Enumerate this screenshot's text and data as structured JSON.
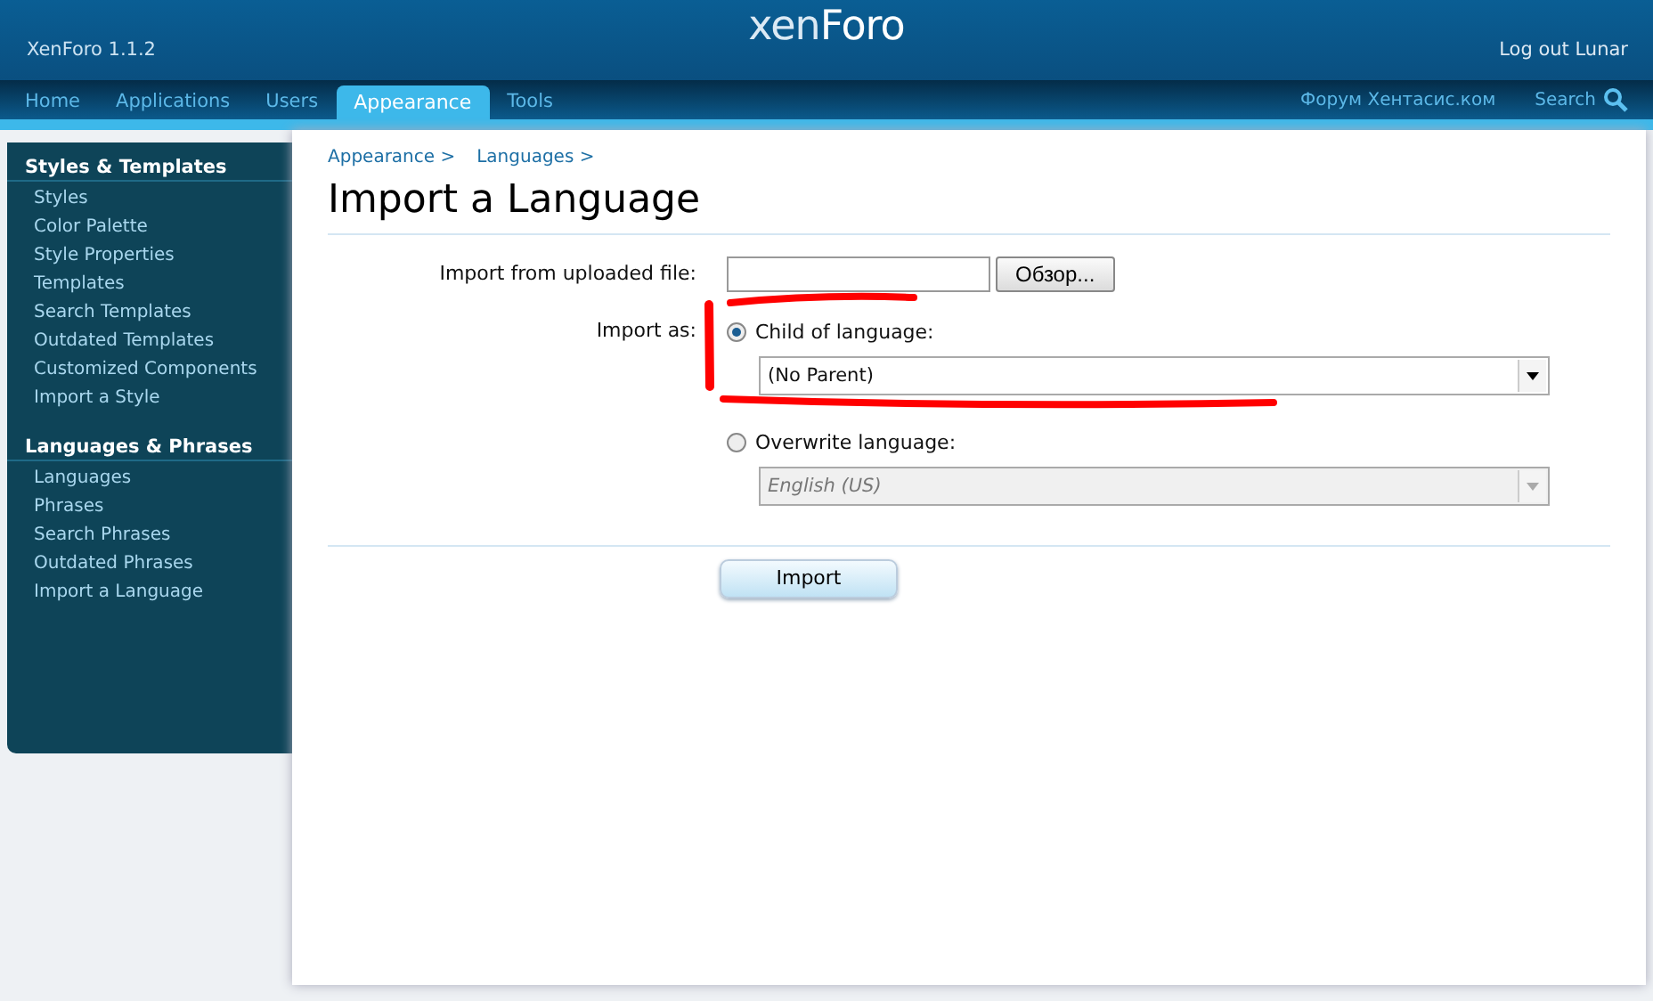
{
  "header": {
    "version": "XenForo 1.1.2",
    "logo": "xen**Foro**",
    "logout": "Log out Lunar"
  },
  "tabs": [
    {
      "label": "Home",
      "selected": false
    },
    {
      "label": "Applications",
      "selected": false
    },
    {
      "label": "Users",
      "selected": false
    },
    {
      "label": "Appearance",
      "selected": true
    },
    {
      "label": "Tools",
      "selected": false
    }
  ],
  "nav_links": {
    "forum": "Форум Хентасис.ком",
    "search": "Search"
  },
  "sidebar": [
    {
      "heading": "Styles & Templates",
      "items": [
        "Styles",
        "Color Palette",
        "Style Properties",
        "Templates",
        "Search Templates",
        "Outdated Templates",
        "Customized Components",
        "Import a Style"
      ]
    },
    {
      "heading": "Languages & Phrases",
      "items": [
        "Languages",
        "Phrases",
        "Search Phrases",
        "Outdated Phrases",
        "Import a Language"
      ]
    }
  ],
  "breadcrumbs": [
    "Appearance >",
    "Languages >"
  ],
  "title": "Import a Language",
  "form": {
    "file_label": "Import from uploaded file:",
    "browse_button": "Обзор...",
    "import_as_label": "Import as:",
    "options": [
      {
        "label": "Child of language:",
        "selected": true,
        "select_value": "(No Parent)",
        "disabled": false
      },
      {
        "label": "Overwrite language:",
        "selected": false,
        "select_value": "English (US)",
        "disabled": true
      }
    ],
    "submit": "Import"
  }
}
